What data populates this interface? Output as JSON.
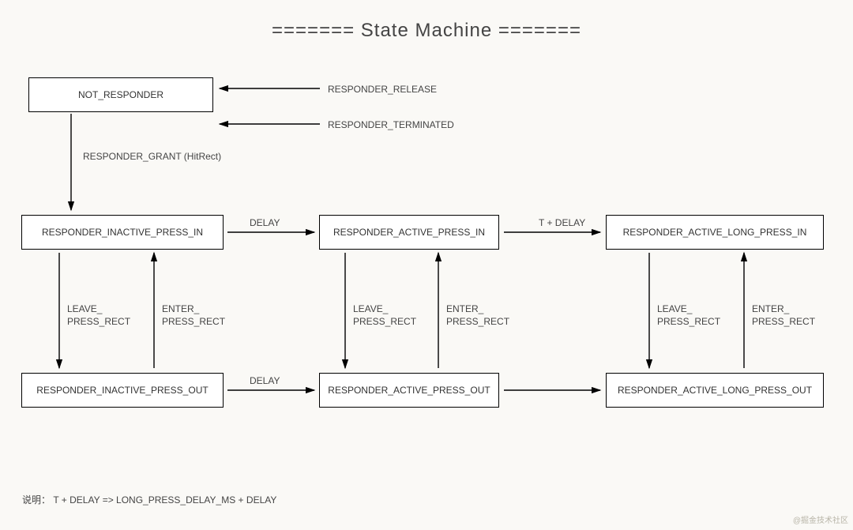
{
  "title": "======= State Machine =======",
  "states": {
    "not_responder": "NOT_RESPONDER",
    "inactive_in": "RESPONDER_INACTIVE_PRESS_IN",
    "active_in": "RESPONDER_ACTIVE_PRESS_IN",
    "active_long_in": "RESPONDER_ACTIVE_LONG_PRESS_IN",
    "inactive_out": "RESPONDER_INACTIVE_PRESS_OUT",
    "active_out": "RESPONDER_ACTIVE_PRESS_OUT",
    "active_long_out": "RESPONDER_ACTIVE_LONG_PRESS_OUT"
  },
  "labels": {
    "responder_release": "RESPONDER_RELEASE",
    "responder_terminated": "RESPONDER_TERMINATED",
    "responder_grant": "RESPONDER_GRANT (HitRect)",
    "delay_top": "DELAY",
    "t_plus_delay": "T + DELAY",
    "delay_bottom": "DELAY",
    "leave_press_rect": "LEAVE_\nPRESS_RECT",
    "enter_press_rect": "ENTER_\nPRESS_RECT"
  },
  "note": "说明：  T + DELAY => LONG_PRESS_DELAY_MS + DELAY",
  "watermark": "@掘金技术社区"
}
